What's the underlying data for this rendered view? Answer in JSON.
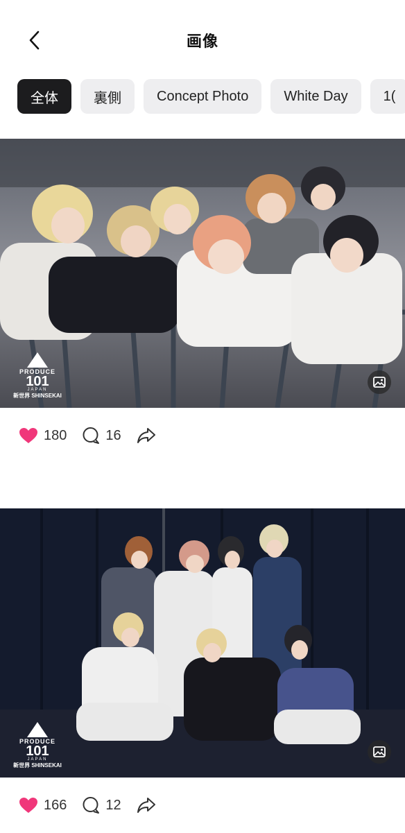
{
  "header": {
    "title": "画像",
    "back_icon": "chevron-left-icon"
  },
  "tabs": [
    {
      "label": "全体",
      "active": true
    },
    {
      "label": "裏側",
      "active": false
    },
    {
      "label": "Concept Photo",
      "active": false
    },
    {
      "label": "White Day",
      "active": false
    },
    {
      "label": "1(",
      "active": false
    }
  ],
  "posts": [
    {
      "logo": {
        "line1": "PRODUCE",
        "line2": "101",
        "line3": "JAPAN",
        "line4": "新世界 SHINSEKAI"
      },
      "media_icon": "image-icon",
      "likes": "180",
      "comments": "16",
      "share_icon": "share-icon",
      "like_color": "#f0377a"
    },
    {
      "logo": {
        "line1": "PRODUCE",
        "line2": "101",
        "line3": "JAPAN",
        "line4": "新世界 SHINSEKAI"
      },
      "media_icon": "image-icon",
      "likes": "166",
      "comments": "12",
      "share_icon": "share-icon",
      "like_color": "#f0377a"
    }
  ]
}
